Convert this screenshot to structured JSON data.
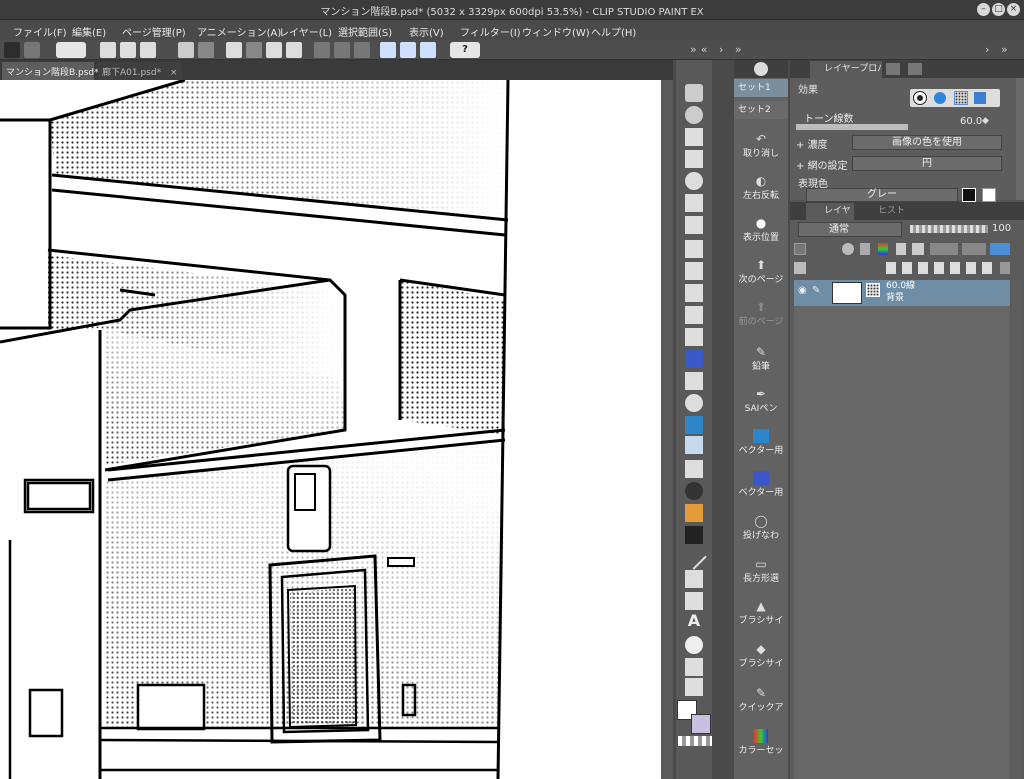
{
  "window": {
    "title": "マンション階段B.psd* (5032 x 3329px 600dpi 53.5%) - CLIP STUDIO PAINT EX"
  },
  "menu": [
    "ファイル(F)",
    "編集(E)",
    "ページ管理(P)",
    "アニメーション(A)",
    "レイヤー(L)",
    "選択範囲(S)",
    "表示(V)",
    "フィルター(I)",
    "ウィンドウ(W)",
    "ヘルプ(H)"
  ],
  "tabs": [
    {
      "label": "マンション階段B.psd*"
    },
    {
      "label": "廊下A01.psd*"
    }
  ],
  "subtool_sets": [
    "セット1",
    "セット2"
  ],
  "subtools": [
    "取り消し",
    "左右反転",
    "表示位置",
    "次のページ",
    "前のページ",
    "鉛筆",
    "SAIペン",
    "ベクター用",
    "ベクター用",
    "投げなわ",
    "長方形選",
    "ブラシサイ",
    "ブラシサイ",
    "クイックア",
    "カラーセッ"
  ],
  "property": {
    "tab_label": "レイヤープロパティ",
    "effect_label": "効果",
    "tone_lines_label": "トーン線数",
    "tone_lines_value": "60.0",
    "density_label": "濃度",
    "density_value": "画像の色を使用",
    "screen_label": "網の設定",
    "screen_value": "円",
    "display_color_label": "表現色",
    "display_color_value": "グレー"
  },
  "layers": {
    "tab_label": "レイヤー",
    "history_label": "ヒストリー",
    "blend_mode": "通常",
    "opacity": "100",
    "items": [
      {
        "line1": "60.0線",
        "line2": "背景"
      }
    ]
  },
  "colors": {
    "accent": "#5b8fd9",
    "selected_layer": "#6f8ea6"
  }
}
